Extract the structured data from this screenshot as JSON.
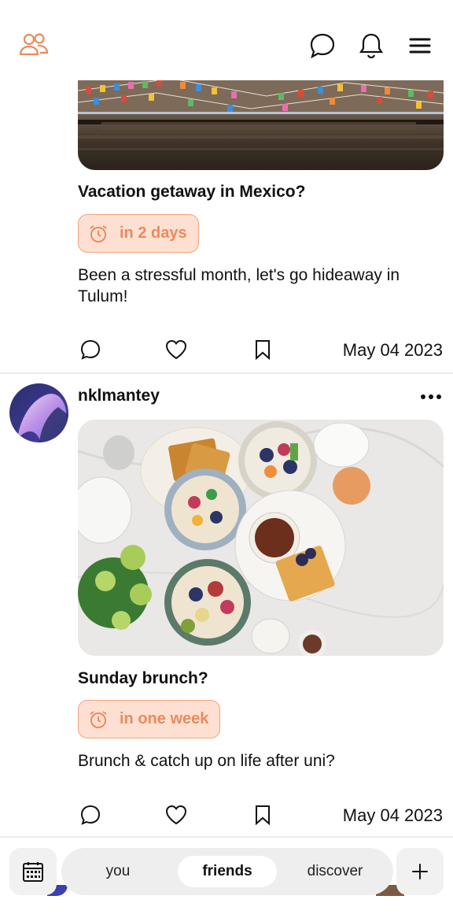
{
  "colors": {
    "accent": "#ec8a5d",
    "badge_bg": "#fde0d2",
    "badge_border": "#f3a27c",
    "text": "#111111"
  },
  "header": {
    "icons": [
      "people-icon",
      "chat-bubble-icon",
      "bell-icon",
      "menu-icon"
    ]
  },
  "posts": [
    {
      "image": "mexico-street-banners-photo",
      "title": "Vacation getaway in Mexico?",
      "badge": "in 2 days",
      "description": "Been a stressful month, let's go hideaway in Tulum!",
      "date": "May 04 2023"
    },
    {
      "username": "nklmantey",
      "image": "brunch-table-photo",
      "title": "Sunday brunch?",
      "badge": "in one week",
      "description": "Brunch & catch up on life after uni?",
      "date": "May 04 2023"
    }
  ],
  "actions": [
    "comment-icon",
    "heart-icon",
    "bookmark-icon",
    "more-options-icon"
  ],
  "bottom_nav": {
    "tabs": [
      "you",
      "friends",
      "discover"
    ],
    "active_tab": "friends",
    "icons": [
      "calendar-icon",
      "plus-icon"
    ]
  }
}
